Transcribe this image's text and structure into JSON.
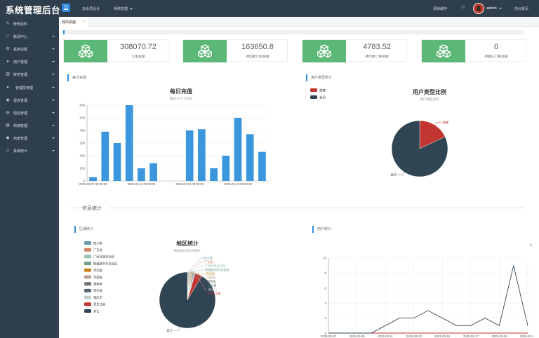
{
  "header": {
    "brand": "系统管理后台",
    "nav": [
      "去会员后台",
      "系统管理"
    ],
    "clear_cache": "清除缓存",
    "username": "admin",
    "home_link": "前台首页"
  },
  "sidebar": {
    "items": [
      {
        "label": "修改资料",
        "icon": "pencil-icon",
        "caret": false
      },
      {
        "label": "新闻中心",
        "icon": "star-icon",
        "caret": true
      },
      {
        "label": "系统设置",
        "icon": "gear-icon",
        "caret": true
      },
      {
        "label": "用户管理",
        "icon": "user-icon",
        "caret": true
      },
      {
        "label": "财务管理",
        "icon": "chart-icon",
        "caret": true
      },
      {
        "label": "管理员管理",
        "icon": "users-icon",
        "caret": true
      },
      {
        "label": "留言管理",
        "icon": "message-icon",
        "caret": true
      },
      {
        "label": "短信管理",
        "icon": "sms-icon",
        "caret": true
      },
      {
        "label": "商城管理",
        "icon": "shop-icon",
        "caret": true
      },
      {
        "label": "商家管理",
        "icon": "merchant-icon",
        "caret": true
      },
      {
        "label": "系统统计",
        "icon": "diamond-icon",
        "caret": true
      }
    ]
  },
  "tabs": [
    {
      "label": "我的桌面",
      "close": "×"
    }
  ],
  "stats": [
    {
      "value": "308070.72",
      "label": "订单总额"
    },
    {
      "value": "163650.8",
      "label": "待匹配订单总额"
    },
    {
      "value": "4783.52",
      "label": "待付款订单总额"
    },
    {
      "value": "0",
      "label": "待确认订单总额"
    }
  ],
  "panels": {
    "daily": "每日充值",
    "user_type": "用户类型统计",
    "region": "区域统计",
    "users": "用户统计"
  },
  "section_divider": "信息统计",
  "chart_data": [
    {
      "type": "bar",
      "title": "每日充值",
      "subtitle": "最近15个工作日",
      "x": [
        "2025-03-07 00:00:00",
        "",
        "",
        "",
        "2025-03-11 00:00:00",
        "",
        "",
        "",
        "2025-03-15 00:00:00",
        "",
        "",
        "",
        "2025-03-19 00:00:00",
        "",
        ""
      ],
      "values": [
        30,
        390,
        300,
        600,
        100,
        140,
        0,
        0,
        400,
        410,
        100,
        200,
        500,
        370,
        230
      ],
      "ylim": [
        0,
        600
      ],
      "yticks": [
        0,
        100,
        200,
        300,
        400,
        500,
        600
      ],
      "xlabel": "",
      "ylabel": "",
      "color": "#3a96dd"
    },
    {
      "type": "pie",
      "title": "用户类型比例",
      "subtitle": "用户类型比例",
      "slices": [
        {
          "name": "游客",
          "value": 18,
          "color": "#c23531"
        },
        {
          "name": "会员",
          "value": 82,
          "color": "#2f4554"
        }
      ],
      "legend": "top-left"
    },
    {
      "type": "pie",
      "title": "地区统计",
      "subtitle": "根据会员所在地统计",
      "slices": [
        {
          "name": "四川省",
          "value": 0.5,
          "color": "#61a0a8"
        },
        {
          "name": "广东省",
          "value": 0.5,
          "color": "#d48265"
        },
        {
          "name": "广西壮族自治区",
          "value": 0.5,
          "color": "#91c7ae"
        },
        {
          "name": "新疆维吾尔自治区",
          "value": 0.5,
          "color": "#749f83"
        },
        {
          "name": "河北省",
          "value": 0.5,
          "color": "#ca8622"
        },
        {
          "name": "河南省",
          "value": 0.5,
          "color": "#bda29a"
        },
        {
          "name": "湖南省",
          "value": 0.5,
          "color": "#6e7074"
        },
        {
          "name": "贵州省",
          "value": 0.5,
          "color": "#546570"
        },
        {
          "name": "重庆市",
          "value": 0.5,
          "color": "#c4ccd3"
        },
        {
          "name": "黑龙江省",
          "value": 4,
          "color": "#c23531"
        },
        {
          "name": "其它",
          "value": 91,
          "color": "#2f4554"
        }
      ],
      "legend": "top-left"
    },
    {
      "type": "line",
      "title": "",
      "x": [
        "2025-03-07",
        "2025-03-08",
        "2025-03-09",
        "2025-03-10",
        "2025-03-11",
        "2025-03-12",
        "2025-03-13",
        "2025-03-14",
        "2025-03-15",
        "2025-03-16",
        "2025-03-17",
        "2025-03-18",
        "2025-03-19",
        "2025-03-20",
        "2025-03-21"
      ],
      "xticks": [
        "2025-03-07",
        "2025-03-09",
        "2025-03-11",
        "2025-03-13",
        "2025-03-15",
        "2025-03-17",
        "2025-03-19",
        "2025-03-21"
      ],
      "series": [
        {
          "values": [
            0,
            0,
            0,
            0,
            1,
            2,
            2,
            3,
            2,
            1,
            1,
            2,
            1,
            9,
            1
          ],
          "color": "#2f4554"
        },
        {
          "values": [
            0,
            0,
            0,
            0,
            0,
            0,
            0,
            0,
            0,
            0,
            0,
            0,
            0,
            0,
            0
          ],
          "color": "#c23531"
        }
      ],
      "ylim": [
        0,
        10
      ],
      "yticks": [
        0,
        2,
        4,
        6,
        8,
        10
      ]
    }
  ]
}
